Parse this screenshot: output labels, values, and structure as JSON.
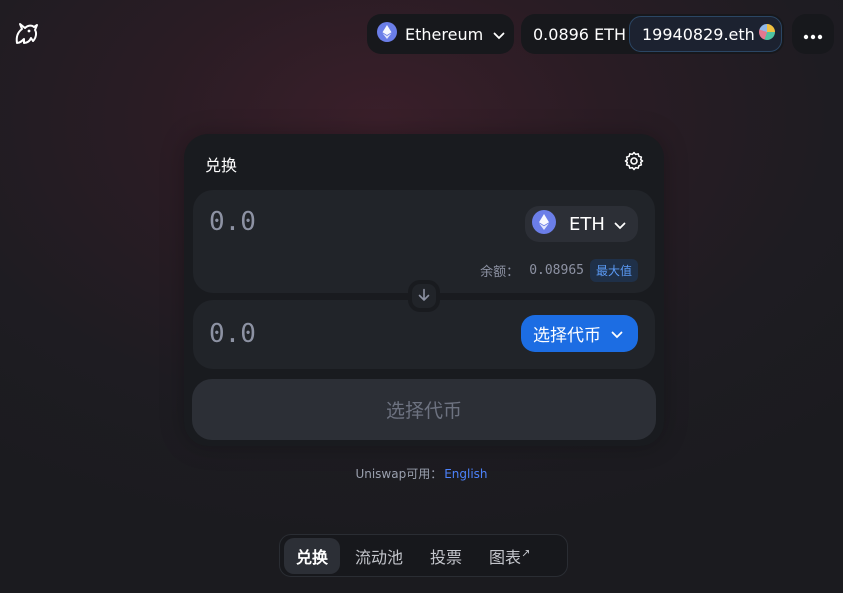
{
  "header": {
    "logo_icon": "unicorn-logo-icon",
    "network": {
      "icon": "ethereum-icon",
      "label": "Ethereum"
    },
    "account": {
      "balance": "0.0896 ETH",
      "address": "19940829.eth"
    },
    "more_icon": "ellipsis-icon"
  },
  "swap": {
    "title": "兑换",
    "settings_icon": "gear-icon",
    "input": {
      "amount": "0.0",
      "token": "ETH",
      "balance_label": "余额：",
      "balance_value": "0.08965",
      "max_label": "最大值"
    },
    "output": {
      "amount": "0.0",
      "select_label": "选择代币"
    },
    "action_label": "选择代币"
  },
  "footer": {
    "note": "Uniswap可用：",
    "language": "English"
  },
  "nav": {
    "items": [
      {
        "label": "兑换",
        "active": true
      },
      {
        "label": "流动池"
      },
      {
        "label": "投票"
      },
      {
        "label": "图表"
      }
    ],
    "external_mark": "↗"
  },
  "colors": {
    "accent": "#1c6de3",
    "card": "#191b1f",
    "panel": "#212429",
    "link": "#4c82fb"
  }
}
